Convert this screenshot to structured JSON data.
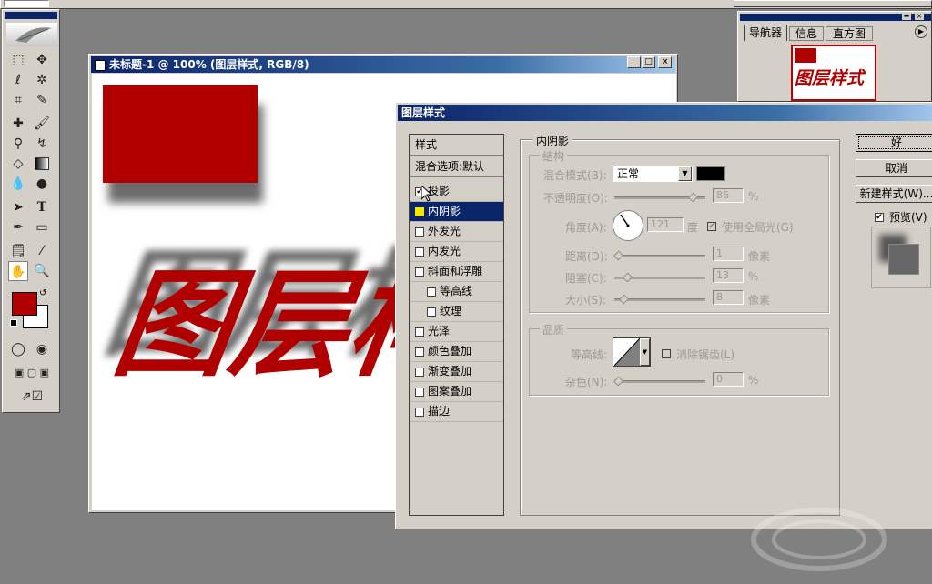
{
  "document": {
    "title": "未标题-1 @ 100% (图层样式, RGB/8)",
    "text_art": "图层样式"
  },
  "dialog": {
    "title": "图层样式",
    "sidebar": {
      "header": "样式",
      "blend_options": "混合选项:默认",
      "items": [
        {
          "label": "投影",
          "checked": true
        },
        {
          "label": "内阴影",
          "checked": false
        },
        {
          "label": "外发光",
          "checked": false
        },
        {
          "label": "内发光",
          "checked": false
        },
        {
          "label": "斜面和浮雕",
          "checked": false
        },
        {
          "label": "等高线",
          "checked": false
        },
        {
          "label": "纹理",
          "checked": false
        },
        {
          "label": "光泽",
          "checked": false
        },
        {
          "label": "颜色叠加",
          "checked": false
        },
        {
          "label": "渐变叠加",
          "checked": false
        },
        {
          "label": "图案叠加",
          "checked": false
        },
        {
          "label": "描边",
          "checked": false
        }
      ]
    },
    "panel": {
      "title": "内阴影",
      "structure": {
        "title": "结构",
        "blend_mode_label": "混合模式(B):",
        "blend_mode_value": "正常",
        "shadow_color": "#000000",
        "opacity_label": "不透明度(O):",
        "opacity_value": "86",
        "opacity_unit": "%",
        "angle_label": "角度(A):",
        "angle_value": "121",
        "angle_unit": "度",
        "global_light_label": "使用全局光(G)",
        "distance_label": "距离(D):",
        "distance_value": "1",
        "distance_unit": "像素",
        "choke_label": "阻塞(C):",
        "choke_value": "13",
        "choke_unit": "%",
        "size_label": "大小(S):",
        "size_value": "8",
        "size_unit": "像素"
      },
      "quality": {
        "title": "品质",
        "contour_label": "等高线:",
        "antialias_label": "消除锯齿(L)",
        "noise_label": "杂色(N):",
        "noise_value": "0",
        "noise_unit": "%"
      }
    },
    "buttons": {
      "ok": "好",
      "cancel": "取消",
      "new_style": "新建样式(W)...",
      "preview": "预览(V)"
    }
  },
  "navigator": {
    "tabs": [
      "导航器",
      "信息",
      "直方图"
    ],
    "thumb_text": "图层样式"
  },
  "colors": {
    "foreground": "#b00000",
    "background": "#ffffff"
  }
}
